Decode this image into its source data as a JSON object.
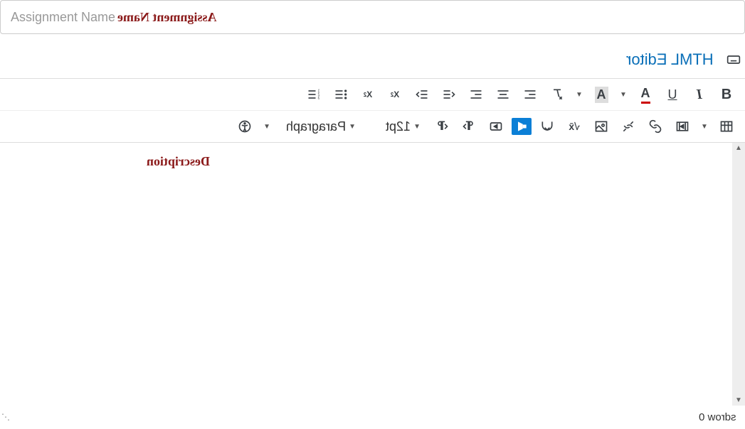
{
  "name_field": {
    "placeholder": "Assignment Name",
    "value": "",
    "overlay_label": "Assignment Name"
  },
  "editor_title": "HTML Editor",
  "toolbar": {
    "row1": {
      "bold": "B",
      "italic": "I",
      "underline": "U",
      "text_color": "A",
      "bg_color": "A",
      "clear_format": "clear-formatting",
      "align_left": "align-left",
      "align_center": "align-center",
      "align_right": "align-right",
      "indent": "indent",
      "outdent": "outdent",
      "superscript": "X²",
      "subscript": "X₂",
      "bullet_list": "bullet-list",
      "number_list": "number-list"
    },
    "row2": {
      "table": "table",
      "media": "media",
      "link": "link",
      "unlink": "unlink",
      "image": "image",
      "equation": "√x",
      "embed": "embed",
      "record": "record-media",
      "insert": "insert",
      "ltr": "ltr",
      "rtl": "rtl",
      "font_size": "12pt",
      "paragraph": "Paragraph",
      "accessibility": "accessibility-checker"
    }
  },
  "content": {
    "description_label": "Description",
    "body": ""
  },
  "footer": {
    "word_count": "0 words"
  }
}
